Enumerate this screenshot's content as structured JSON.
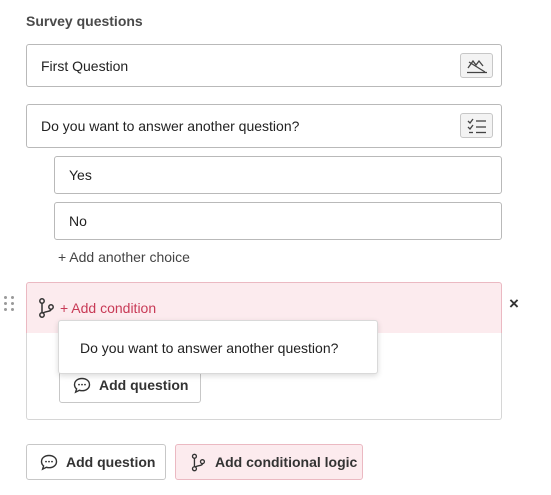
{
  "section": {
    "title": "Survey questions"
  },
  "questions": [
    {
      "text": "First Question",
      "type_icon": "signature-icon"
    },
    {
      "text": "Do you want to answer another question?",
      "type_icon": "checklist-icon",
      "choices": [
        "Yes",
        "No"
      ],
      "add_choice_label": "+ Add another choice"
    }
  ],
  "condition": {
    "add_condition_label": "+ Add condition",
    "close_label": "×",
    "dropdown_option": "Do you want to answer another question?",
    "add_question_label": "Add question",
    "accent_color": "#c83a56",
    "header_bg": "#fcebee"
  },
  "footer": {
    "add_question_label": "Add question",
    "add_conditional_logic_label": "Add conditional logic"
  }
}
